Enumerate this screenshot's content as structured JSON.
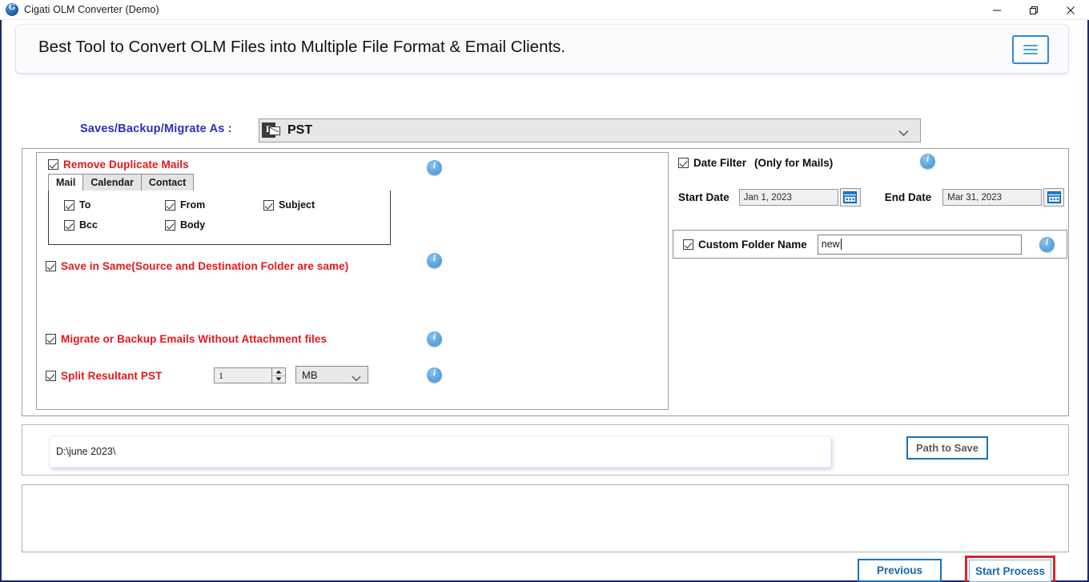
{
  "window": {
    "title": "Cigati OLM Converter (Demo)",
    "app_icon": "cigati-logo-icon",
    "controls": {
      "minimize": "minimize-icon",
      "maximize": "restore-icon",
      "close": "close-icon"
    }
  },
  "banner": {
    "headline": "Best Tool to Convert OLM Files into Multiple File Format & Email Clients.",
    "menu_icon": "hamburger-menu-icon"
  },
  "format_row": {
    "label": "Saves/Backup/Migrate As :",
    "selected_value": "PST",
    "value_icon": "pst-file-icon",
    "dropdown_icon": "chevron-down-icon"
  },
  "left_panel": {
    "remove_duplicate": {
      "label": "Remove Duplicate Mails",
      "checked": true,
      "info_icon": "info-icon"
    },
    "tabs": [
      {
        "label": "Mail",
        "active": true
      },
      {
        "label": "Calendar",
        "active": false
      },
      {
        "label": "Contact",
        "active": false
      }
    ],
    "duplicate_fields": [
      {
        "label": "To",
        "checked": true
      },
      {
        "label": "From",
        "checked": true
      },
      {
        "label": "Subject",
        "checked": true
      },
      {
        "label": "Bcc",
        "checked": true
      },
      {
        "label": "Body",
        "checked": true
      }
    ],
    "save_in_same": {
      "label": "Save in Same(Source and Destination Folder are same)",
      "checked": true,
      "info_icon": "info-icon"
    },
    "without_attachment": {
      "label": "Migrate or Backup Emails Without Attachment files",
      "checked": true,
      "info_icon": "info-icon"
    },
    "split_pst": {
      "label": "Split Resultant PST",
      "checked": true,
      "size_value": "1",
      "unit_value": "MB",
      "unit_dropdown_icon": "chevron-down-icon",
      "stepper_up_icon": "caret-up-icon",
      "stepper_down_icon": "caret-down-icon",
      "info_icon": "info-icon"
    }
  },
  "right_panel": {
    "date_filter": {
      "label": "Date Filter",
      "note": "(Only for Mails)",
      "checked": true,
      "info_icon": "info-icon"
    },
    "start_date": {
      "label": "Start Date",
      "value": "Jan 1, 2023",
      "calendar_icon": "calendar-icon"
    },
    "end_date": {
      "label": "End Date",
      "value": "Mar 31, 2023",
      "calendar_icon": "calendar-icon"
    },
    "custom_folder": {
      "label": "Custom Folder Name",
      "checked": true,
      "value": "new",
      "info_icon": "info-icon"
    }
  },
  "path_section": {
    "path_value": "D:\\june 2023\\",
    "path_placeholder": "",
    "button_label": "Path to Save"
  },
  "footer": {
    "previous_label": "Previous",
    "start_label": "Start Process"
  },
  "colors": {
    "brand_blue": "#2d2fbd",
    "accent_red": "#e8161d",
    "button_blue": "#1a73b8",
    "highlight_red": "#e02127",
    "info_blue": "#5ba5e0"
  }
}
